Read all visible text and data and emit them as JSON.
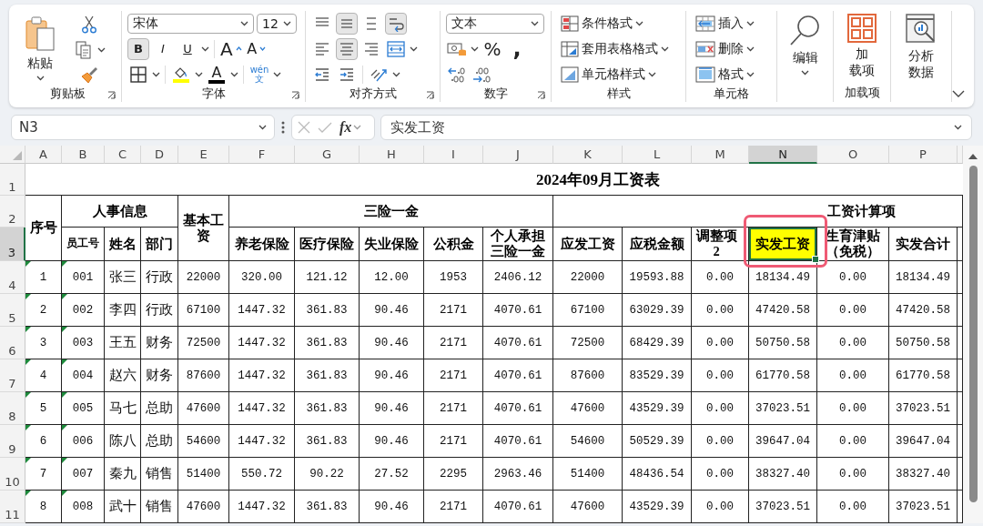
{
  "ribbon": {
    "clipboard": {
      "label": "剪贴板",
      "paste": "粘贴"
    },
    "font": {
      "label": "字体",
      "font_name": "宋体",
      "font_size": "12",
      "styles": [
        {
          "glyph": "B",
          "pressed": true
        },
        {
          "glyph": "I",
          "pressed": false
        },
        {
          "glyph": "U",
          "pressed": false
        }
      ],
      "grow": "A",
      "shrink": "A",
      "color_glyph": "A",
      "phonetic": [
        "wén",
        "文"
      ]
    },
    "alignment": {
      "label": "对齐方式",
      "buttons": [
        {
          "kind": "top",
          "pressed": false
        },
        {
          "kind": "middle",
          "pressed": true
        },
        {
          "kind": "bottom",
          "pressed": false
        },
        {
          "kind": "wrap",
          "pressed": true
        },
        {
          "kind": "left",
          "pressed": false
        },
        {
          "kind": "center",
          "pressed": true
        },
        {
          "kind": "right",
          "pressed": false
        },
        {
          "kind": "merge",
          "pressed": false
        },
        {
          "kind": "outdent",
          "pressed": false
        },
        {
          "kind": "indent",
          "pressed": false
        },
        {
          "kind": "orientation",
          "pressed": false
        }
      ]
    },
    "number": {
      "label": "数字",
      "format": "文本",
      "percent": "%",
      "comma": ","
    },
    "styles": {
      "label": "样式",
      "items": [
        {
          "kind": "conditional",
          "text": "条件格式"
        },
        {
          "kind": "table",
          "text": "套用表格格式"
        },
        {
          "kind": "cell",
          "text": "单元格样式"
        }
      ]
    },
    "cells": {
      "label": "单元格",
      "items": [
        {
          "kind": "insert",
          "text": "插入"
        },
        {
          "kind": "delete",
          "text": "删除"
        },
        {
          "kind": "format",
          "text": "格式"
        }
      ]
    },
    "editing": {
      "text": "编辑"
    },
    "addins": {
      "label": "加载项",
      "button": [
        "加",
        "载项"
      ]
    },
    "analysis": {
      "button": [
        "分析",
        "数据"
      ]
    }
  },
  "formula_bar": {
    "name_box": "N3",
    "fx": "fx",
    "formula": "实发工资"
  },
  "sheet": {
    "columns": [
      {
        "label": "A",
        "selected": false
      },
      {
        "label": "B",
        "selected": false
      },
      {
        "label": "C",
        "selected": false
      },
      {
        "label": "D",
        "selected": false
      },
      {
        "label": "E",
        "selected": false
      },
      {
        "label": "F",
        "selected": false
      },
      {
        "label": "G",
        "selected": false
      },
      {
        "label": "H",
        "selected": false
      },
      {
        "label": "I",
        "selected": false
      },
      {
        "label": "J",
        "selected": false
      },
      {
        "label": "K",
        "selected": false
      },
      {
        "label": "L",
        "selected": false
      },
      {
        "label": "M",
        "selected": false
      },
      {
        "label": "N",
        "selected": true
      },
      {
        "label": "O",
        "selected": false
      },
      {
        "label": "P",
        "selected": false
      }
    ],
    "rows": [
      {
        "label": "1",
        "selected": false
      },
      {
        "label": "2",
        "selected": false
      },
      {
        "label": "3",
        "selected": true
      },
      {
        "label": "4",
        "selected": false
      },
      {
        "label": "5",
        "selected": false
      },
      {
        "label": "6",
        "selected": false
      },
      {
        "label": "7",
        "selected": false
      },
      {
        "label": "8",
        "selected": false
      },
      {
        "label": "9",
        "selected": false
      },
      {
        "label": "10",
        "selected": false
      },
      {
        "label": "11",
        "selected": false
      }
    ],
    "title": "2024年09月工资表",
    "header": {
      "seq": "序号",
      "personnel": "人事信息",
      "base_pay": "基本工资",
      "insurance": "三险一金",
      "payroll": "工资计算项",
      "columns": [
        {
          "text": "员工号",
          "selected": false,
          "filled": false,
          "annotated": false
        },
        {
          "text": "姓名",
          "selected": false,
          "filled": false,
          "annotated": false
        },
        {
          "text": "部门",
          "selected": false,
          "filled": false,
          "annotated": false
        },
        {
          "text": "养老保险",
          "selected": false,
          "filled": false,
          "annotated": false
        },
        {
          "text": "医疗保险",
          "selected": false,
          "filled": false,
          "annotated": false
        },
        {
          "text": "失业保险",
          "selected": false,
          "filled": false,
          "annotated": false
        },
        {
          "text": "公积金",
          "selected": false,
          "filled": false,
          "annotated": false
        },
        {
          "text": "个人承担三险一金",
          "selected": false,
          "filled": false,
          "annotated": false
        },
        {
          "text": "应发工资",
          "selected": false,
          "filled": false,
          "annotated": false
        },
        {
          "text": "应税金额",
          "selected": false,
          "filled": false,
          "annotated": false
        },
        {
          "text": "调整项2",
          "selected": false,
          "filled": false,
          "annotated": false
        },
        {
          "text": "实发工资",
          "selected": true,
          "filled": true,
          "annotated": true
        },
        {
          "text": "生育津贴（免税）",
          "selected": false,
          "filled": false,
          "annotated": false
        },
        {
          "text": "实发合计",
          "selected": false,
          "filled": false,
          "annotated": false
        }
      ]
    },
    "data": [
      {
        "flagged": true,
        "cells": [
          "1",
          "001",
          "张三",
          "行政",
          "22000",
          "320.00",
          "121.12",
          "12.00",
          "1953",
          "2406.12",
          "22000",
          "19593.88",
          "0.00",
          "18134.49",
          "0.00",
          "18134.49"
        ]
      },
      {
        "flagged": true,
        "cells": [
          "2",
          "002",
          "李四",
          "行政",
          "67100",
          "1447.32",
          "361.83",
          "90.46",
          "2171",
          "4070.61",
          "67100",
          "63029.39",
          "0.00",
          "47420.58",
          "0.00",
          "47420.58"
        ]
      },
      {
        "flagged": true,
        "cells": [
          "3",
          "003",
          "王五",
          "财务",
          "72500",
          "1447.32",
          "361.83",
          "90.46",
          "2171",
          "4070.61",
          "72500",
          "68429.39",
          "0.00",
          "50750.58",
          "0.00",
          "50750.58"
        ]
      },
      {
        "flagged": true,
        "cells": [
          "4",
          "004",
          "赵六",
          "财务",
          "87600",
          "1447.32",
          "361.83",
          "90.46",
          "2171",
          "4070.61",
          "87600",
          "83529.39",
          "0.00",
          "61770.58",
          "0.00",
          "61770.58"
        ]
      },
      {
        "flagged": true,
        "cells": [
          "5",
          "005",
          "马七",
          "总助",
          "47600",
          "1447.32",
          "361.83",
          "90.46",
          "2171",
          "4070.61",
          "47600",
          "43529.39",
          "0.00",
          "37023.51",
          "0.00",
          "37023.51"
        ]
      },
      {
        "flagged": true,
        "cells": [
          "6",
          "006",
          "陈八",
          "总助",
          "54600",
          "1447.32",
          "361.83",
          "90.46",
          "2171",
          "4070.61",
          "54600",
          "50529.39",
          "0.00",
          "39647.04",
          "0.00",
          "39647.04"
        ]
      },
      {
        "flagged": true,
        "cells": [
          "7",
          "007",
          "秦九",
          "销售",
          "51400",
          "550.72",
          "90.22",
          "27.52",
          "2295",
          "2963.46",
          "51400",
          "48436.54",
          "0.00",
          "38327.40",
          "0.00",
          "38327.40"
        ]
      },
      {
        "flagged": true,
        "cells": [
          "8",
          "008",
          "武十",
          "销售",
          "47600",
          "1447.32",
          "361.83",
          "90.46",
          "2171",
          "4070.61",
          "47600",
          "43529.39",
          "0.00",
          "37023.51",
          "0.00",
          "37023.51"
        ]
      }
    ]
  }
}
